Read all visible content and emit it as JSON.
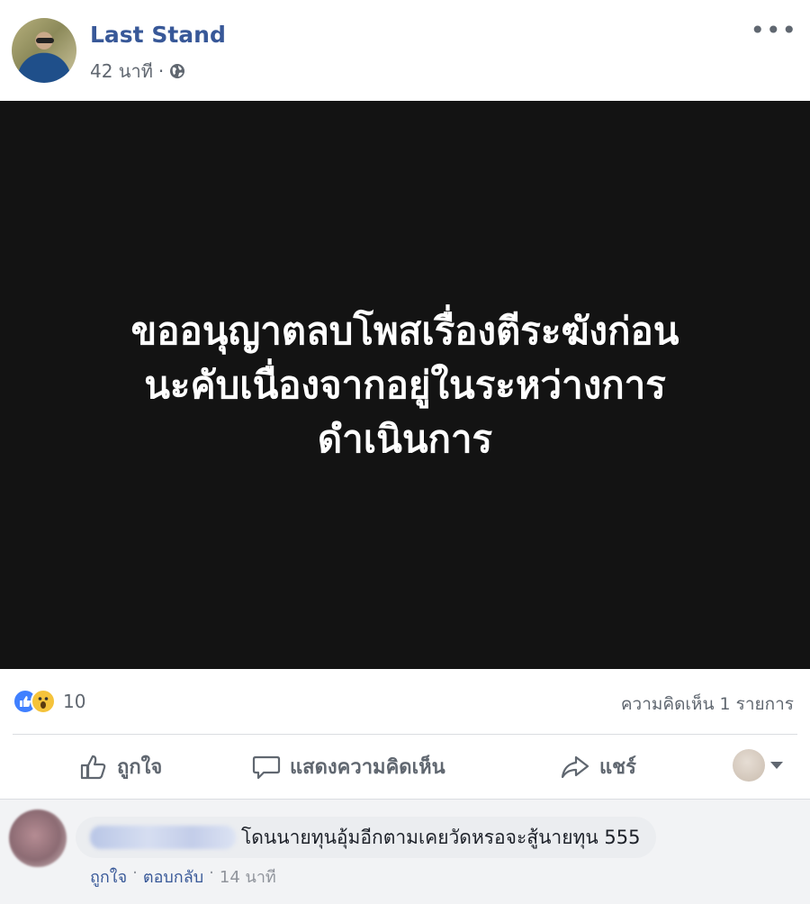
{
  "post": {
    "author": "Last Stand",
    "time": "42 นาที",
    "separator": "·",
    "media_text_lines": [
      "ขออนุญาตลบโพสเรื่องตีระฆังก่อน",
      "นะคับเนื่องจากอยู่ในระหว่างการ",
      "ดำเนินการ"
    ]
  },
  "stats": {
    "reaction_count": "10",
    "comments_count": "ความคิดเห็น 1 รายการ"
  },
  "actions": {
    "like": "ถูกใจ",
    "comment": "แสดงความคิดเห็น",
    "share": "แชร์"
  },
  "comment": {
    "text": "โดนนายทุนอุ้มอีกตามเคยวัดหรอจะสู้นายทุน 555",
    "like": "ถูกใจ",
    "reply": "ตอบกลับ",
    "time": "14 นาที",
    "separator": "·"
  },
  "colors": {
    "link": "#385898",
    "like_blue": "#4080ff",
    "wow_yellow": "#f5c33b",
    "media_bg": "#131313"
  },
  "icons": [
    "globe-icon",
    "more-icon",
    "like-reaction-icon",
    "wow-reaction-icon",
    "thumbs-up-icon",
    "comment-icon",
    "share-icon",
    "caret-down-icon"
  ]
}
